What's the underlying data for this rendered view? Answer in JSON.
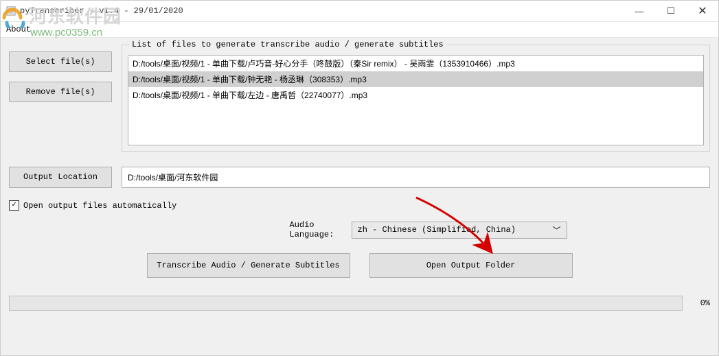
{
  "window": {
    "title": "pyTranscriber - v1.4 - 29/01/2020"
  },
  "menubar": {
    "about": "About"
  },
  "buttons": {
    "select_files": "Select file(s)",
    "remove_files": "Remove file(s)",
    "output_location": "Output Location",
    "transcribe": "Transcribe Audio / Generate Subtitles",
    "open_output": "Open Output Folder"
  },
  "group": {
    "title": "List of files to generate transcribe audio / generate subtitles"
  },
  "files": [
    {
      "path": "D:/tools/桌面/视频/1 - 单曲下载/卢巧音-好心分手（咚鼓版）（秦Sir remix） - 吴雨霏（1353910466）.mp3",
      "selected": false
    },
    {
      "path": "D:/tools/桌面/视频/1 - 单曲下载/钟无艳 - 杨丞琳（308353）.mp3",
      "selected": true
    },
    {
      "path": "D:/tools/桌面/视频/1 - 单曲下载/左边 - 唐禹哲（22740077）.mp3",
      "selected": false
    }
  ],
  "output": {
    "path": "D:/tools/桌面/河东软件园"
  },
  "checkbox": {
    "label": "Open output files automatically",
    "checked": true
  },
  "language": {
    "label": "Audio Language:",
    "selected": "zh - Chinese (Simplified, China)"
  },
  "progress": {
    "percent": "0%"
  },
  "watermark": {
    "text_main": "河东软件园",
    "url": "www.pc0359.cn"
  }
}
